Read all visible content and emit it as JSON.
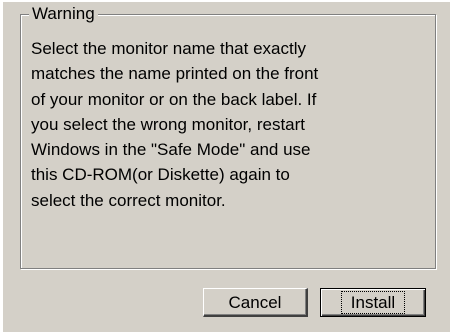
{
  "dialog": {
    "group": {
      "title": "Warning",
      "message": "Select the monitor name that exactly\nmatches the name printed on the front\nof your monitor or on the back label. If\nyou select the wrong monitor, restart\nWindows in the \"Safe Mode\" and use\nthis CD-ROM(or Diskette) again to\nselect the correct monitor."
    },
    "buttons": {
      "cancel_label": "Cancel",
      "install_label": "Install"
    }
  },
  "colors": {
    "dialog_face": "#d4d0c8",
    "shadow": "#808080",
    "highlight": "#ffffff",
    "text": "#000000"
  }
}
